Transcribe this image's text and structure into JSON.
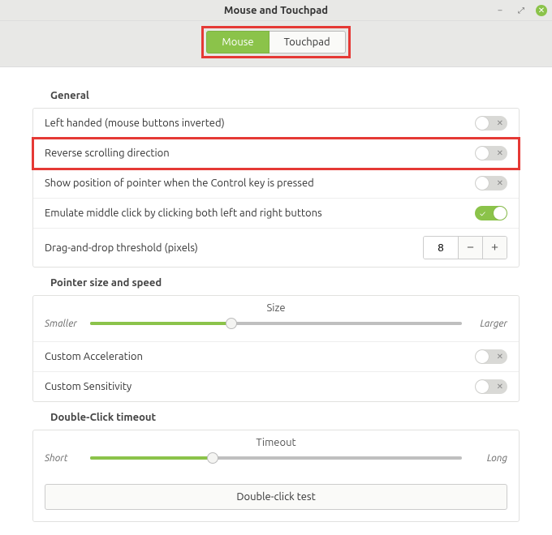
{
  "window": {
    "title": "Mouse and Touchpad"
  },
  "tabs": {
    "mouse": "Mouse",
    "touchpad": "Touchpad",
    "active": "mouse"
  },
  "sections": {
    "general": {
      "title": "General",
      "left_handed": {
        "label": "Left handed (mouse buttons inverted)",
        "on": false
      },
      "reverse_scroll": {
        "label": "Reverse scrolling direction",
        "on": false
      },
      "show_pointer": {
        "label": "Show position of pointer when the Control key is pressed",
        "on": false
      },
      "emulate_middle": {
        "label": "Emulate middle click by clicking both left and right buttons",
        "on": true
      },
      "drag_threshold": {
        "label": "Drag-and-drop threshold (pixels)",
        "value": "8"
      }
    },
    "pointer": {
      "title": "Pointer size and speed",
      "size": {
        "caption": "Size",
        "min_label": "Smaller",
        "max_label": "Larger",
        "value_pct": 38
      },
      "custom_accel": {
        "label": "Custom Acceleration",
        "on": false
      },
      "custom_sens": {
        "label": "Custom Sensitivity",
        "on": false
      }
    },
    "dblclick": {
      "title": "Double-Click timeout",
      "timeout": {
        "caption": "Timeout",
        "min_label": "Short",
        "max_label": "Long",
        "value_pct": 33
      },
      "test_label": "Double-click test"
    }
  }
}
